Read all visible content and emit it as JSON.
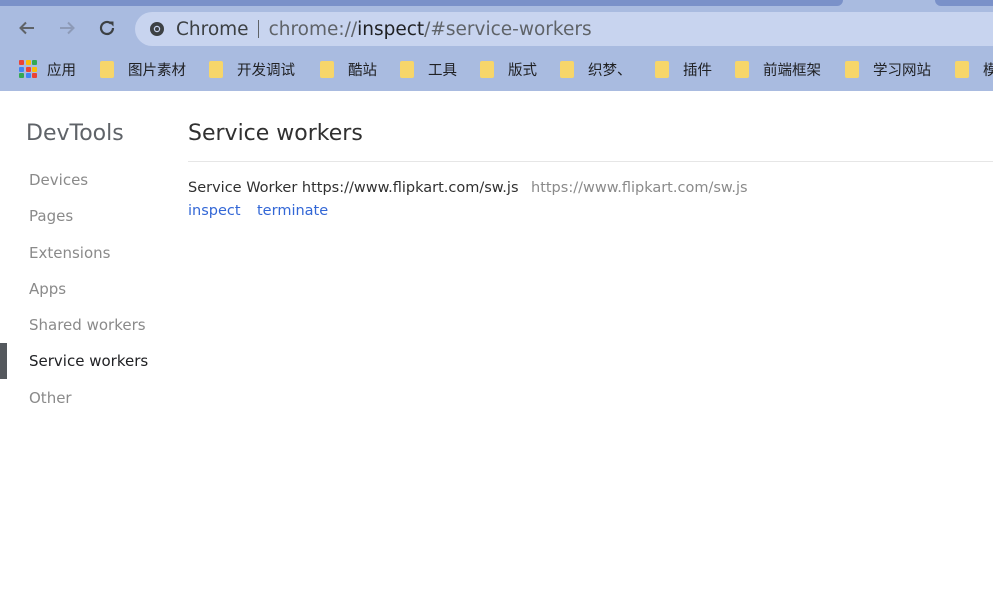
{
  "browser": {
    "omnibox": {
      "chip": "Chrome",
      "url_prefix": "chrome://",
      "url_host": "inspect",
      "url_rest": "/#service-workers"
    },
    "bookmarks": {
      "apps_label": "应用",
      "folders": [
        "图片素材",
        "开发调试",
        "酷站",
        "工具",
        "版式",
        "织梦、",
        "插件",
        "前端框架",
        "学习网站",
        "模"
      ]
    },
    "colors": {
      "chrome_bg": "#a9bbe0",
      "omnibox_bg": "#c8d4ef",
      "folder": "#f7d66a",
      "link": "#3367d6"
    }
  },
  "sidebar": {
    "title": "DevTools",
    "items": [
      {
        "label": "Devices"
      },
      {
        "label": "Pages"
      },
      {
        "label": "Extensions"
      },
      {
        "label": "Apps"
      },
      {
        "label": "Shared workers"
      },
      {
        "label": "Service workers",
        "selected": true
      },
      {
        "label": "Other"
      }
    ]
  },
  "main": {
    "title": "Service workers",
    "workers": [
      {
        "name": "Service Worker https://www.flipkart.com/sw.js",
        "url": "https://www.flipkart.com/sw.js",
        "actions": [
          "inspect",
          "terminate"
        ]
      }
    ]
  }
}
